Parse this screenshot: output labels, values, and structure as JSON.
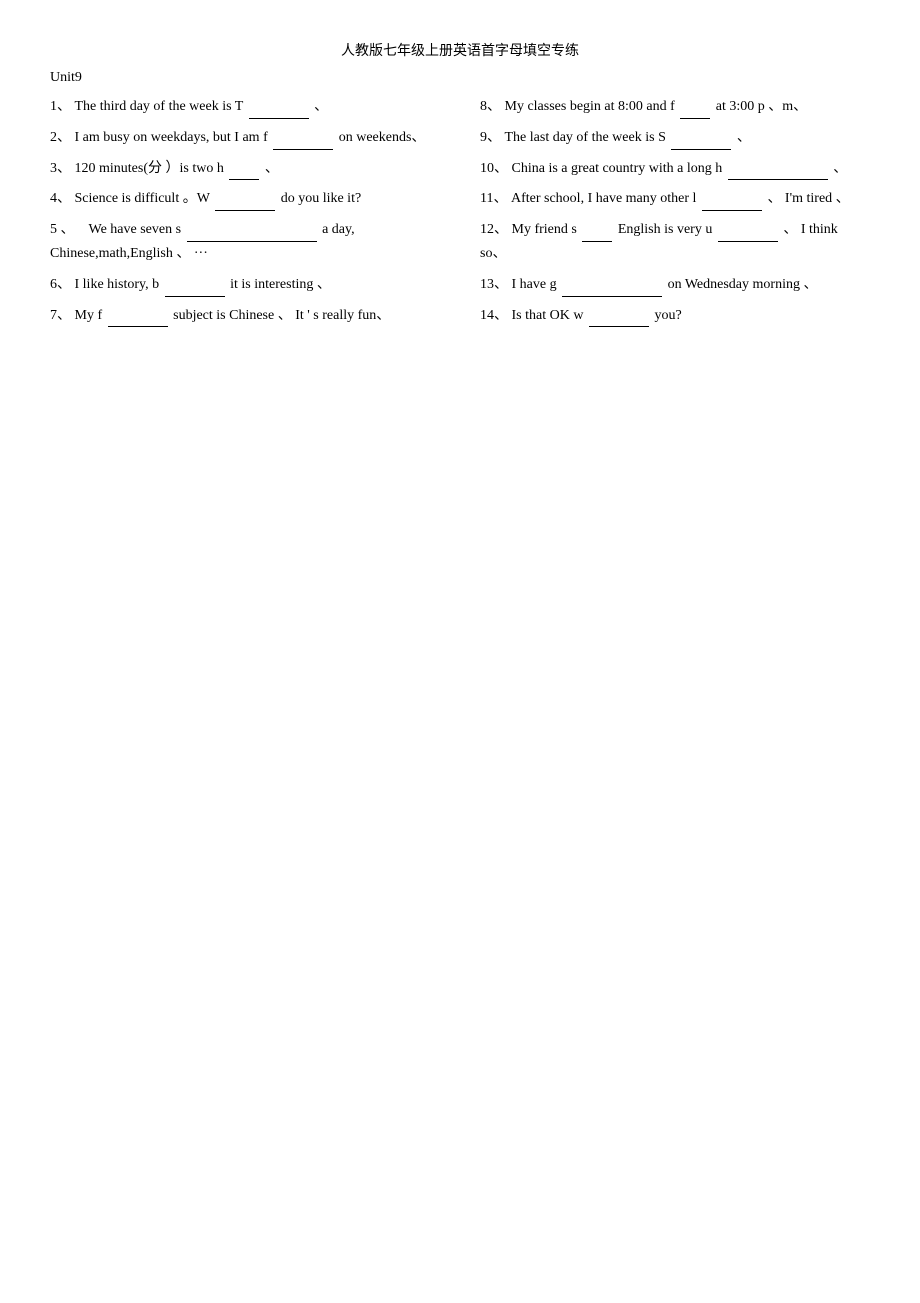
{
  "title": "人教版七年级上册英语首字母填空专练",
  "unit": "Unit9",
  "left_items": [
    {
      "number": "1、",
      "text_before": "The third day of the week is T",
      "blank_size": "md",
      "text_after": "、"
    },
    {
      "number": "2、",
      "text_before": "I am busy on weekdays, but I am f",
      "blank_size": "md",
      "text_after": "on weekends、"
    },
    {
      "number": "3、",
      "text_before": "120 minutes(分）is two h",
      "blank_size": "sm",
      "text_after": "、"
    },
    {
      "number": "4、",
      "text_before": "Science is difficult 。W",
      "blank_size": "md",
      "text_after": "do you like it?"
    },
    {
      "number": "5、",
      "line1": "We have seven s",
      "blank_size": "xl",
      "line1_after": "a day,",
      "line2": "Chinese,math,English 、 ···"
    },
    {
      "number": "6、",
      "text_before": "I like history, b",
      "blank_size": "md",
      "text_after": "it is interesting 、"
    },
    {
      "number": "7、",
      "text_before": "My f",
      "blank_size": "md",
      "text_after": "subject is Chinese 、 It ' s really fun、"
    }
  ],
  "right_items": [
    {
      "number": "8、",
      "text_before": "My classes begin at 8:00 and f",
      "blank_size": "sm",
      "text_after": "at 3:00 p 、m、"
    },
    {
      "number": "9、",
      "text_before": "The last day of the week is S",
      "blank_size": "md",
      "text_after": "、"
    },
    {
      "number": "10、",
      "text_before": "China is a great country with a long h",
      "blank_size": "lg",
      "text_after": "、"
    },
    {
      "number": "11、",
      "text_before": "After school, I have many other l",
      "blank_size": "md",
      "text_after": "、 I'm tired 、"
    },
    {
      "number": "12、",
      "text_before": "My friend s",
      "blank_size": "sm",
      "text_middle": "English is very u",
      "blank_size2": "md",
      "text_after": "、 I think",
      "line2": "so、"
    },
    {
      "number": "13、",
      "text_before": "I have g",
      "blank_size": "lg",
      "text_after": "on Wednesday morning 、"
    },
    {
      "number": "14、",
      "text_before": "Is that OK w",
      "blank_size": "md",
      "text_after": "you?"
    }
  ]
}
